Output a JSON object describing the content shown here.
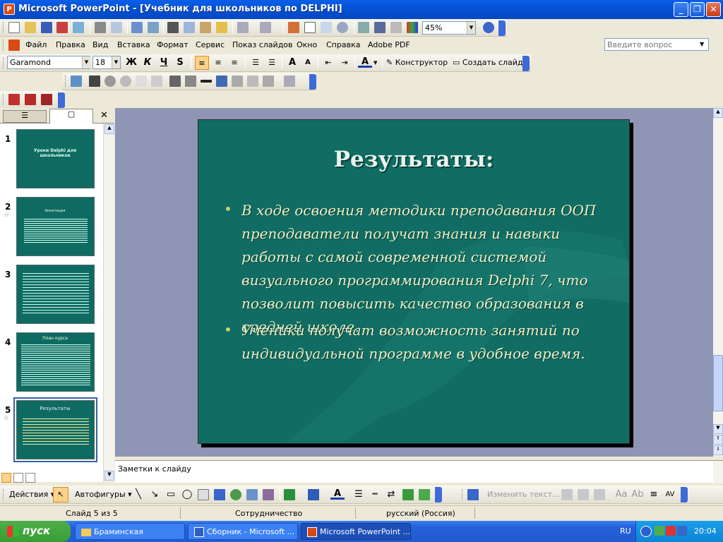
{
  "window": {
    "title": "Microsoft PowerPoint - [Учебник для школьников по DELPHI]",
    "app_icon": "P"
  },
  "toolbar_std": {
    "zoom": "45%"
  },
  "menu": {
    "items": [
      "Файл",
      "Правка",
      "Вид",
      "Вставка",
      "Формат",
      "Сервис",
      "Показ слайдов",
      "Окно",
      "Справка",
      "Adobe PDF"
    ],
    "help_placeholder": "Введите вопрос"
  },
  "format_bar": {
    "font": "Garamond",
    "size": "18",
    "bold": "Ж",
    "italic": "К",
    "underline": "Ч",
    "shadow": "S",
    "designer": "Конструктор",
    "new_slide": "Создать слайд"
  },
  "slides_panel": {
    "numbers": [
      "1",
      "2",
      "3",
      "4",
      "5"
    ],
    "thumb_titles": [
      "Уроки Delphi для школьников",
      "Аннотация",
      "",
      "План курса",
      "Результаты"
    ]
  },
  "slide": {
    "title": "Результаты:",
    "bullets": [
      "В ходе освоения методики преподавания ООП преподаватели получат знания и навыки работы с самой современной системой визуального программирования Delphi 7, что позволит повысить качество образования в средней школе.",
      "Ученики получат возможность занятий по индивидуальной программе в удобное время."
    ]
  },
  "notes": {
    "placeholder": "Заметки к слайду"
  },
  "draw_bar": {
    "actions": "Действия",
    "autoshapes": "Автофигуры",
    "change_text": "Изменить текст..."
  },
  "status": {
    "slide": "Слайд 5 из 5",
    "design": "Сотрудничество",
    "language": "русский (Россия)"
  },
  "taskbar": {
    "start": "пуск",
    "tasks": [
      "Браминская",
      "Сборник - Microsoft ...",
      "Microsoft PowerPoint ..."
    ],
    "lang": "RU",
    "clock": "20:04"
  },
  "colors": {
    "slide_bg": "#116d64",
    "title_bar": "#0553d6",
    "taskbar": "#2460d8"
  }
}
